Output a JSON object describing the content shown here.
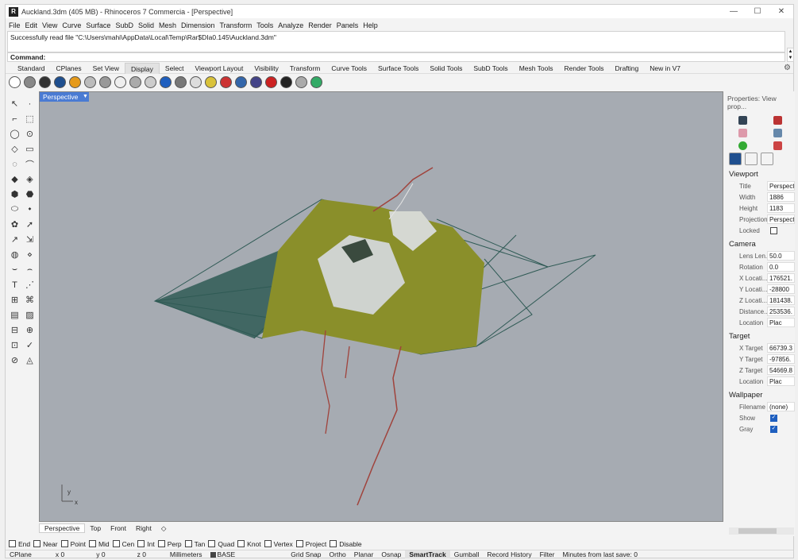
{
  "window": {
    "title": "Auckland.3dm (405 MB) - Rhinoceros 7 Commercia - [Perspective]",
    "app_icon": "rhino-icon",
    "min": "—",
    "max": "☐",
    "close": "✕"
  },
  "menu": [
    "File",
    "Edit",
    "View",
    "Curve",
    "Surface",
    "SubD",
    "Solid",
    "Mesh",
    "Dimension",
    "Transform",
    "Tools",
    "Analyze",
    "Render",
    "Panels",
    "Help"
  ],
  "command": {
    "history": "Successfully read file \"C:\\Users\\mahi\\AppData\\Local\\Temp\\Rar$DIa0.145\\Auckland.3dm\"",
    "prompt": "Command:"
  },
  "toolbar_tabs": [
    "Standard",
    "CPlanes",
    "Set View",
    "Display",
    "Select",
    "Viewport Layout",
    "Visibility",
    "Transform",
    "Curve Tools",
    "Surface Tools",
    "Solid Tools",
    "SubD Tools",
    "Mesh Tools",
    "Render Tools",
    "Drafting",
    "New in V7"
  ],
  "active_tab": "Display",
  "viewport": {
    "label": "Perspective",
    "axis_y": "y",
    "axis_x": "x",
    "dropdown_icon": "▼"
  },
  "viewport_tabs": [
    "Perspective",
    "Top",
    "Front",
    "Right"
  ],
  "viewport_tab_add": "◇",
  "osnaps": [
    {
      "label": "End",
      "on": false
    },
    {
      "label": "Near",
      "on": false
    },
    {
      "label": "Point",
      "on": false
    },
    {
      "label": "Mid",
      "on": false
    },
    {
      "label": "Cen",
      "on": false
    },
    {
      "label": "Int",
      "on": false
    },
    {
      "label": "Perp",
      "on": false
    },
    {
      "label": "Tan",
      "on": false
    },
    {
      "label": "Quad",
      "on": false
    },
    {
      "label": "Knot",
      "on": false
    },
    {
      "label": "Vertex",
      "on": false
    },
    {
      "label": "Project",
      "on": false
    },
    {
      "label": "Disable",
      "on": false
    }
  ],
  "status": {
    "cplane": "CPlane",
    "x": "x 0",
    "y": "y 0",
    "z": "z 0",
    "units": "Millimeters",
    "layer": "BASE",
    "items": [
      "Grid Snap",
      "Ortho",
      "Planar",
      "Osnap",
      "SmartTrack",
      "Gumball",
      "Record History",
      "Filter",
      "Minutes from last save: 0"
    ],
    "active": "SmartTrack"
  },
  "properties": {
    "title": "Properties: View prop...",
    "sections": [
      {
        "name": "Viewport",
        "rows": [
          [
            "Title",
            "Perspect"
          ],
          [
            "Width",
            "1886"
          ],
          [
            "Height",
            "1183"
          ],
          [
            "Projection",
            "Perspect"
          ],
          [
            "Locked",
            ""
          ]
        ]
      },
      {
        "name": "Camera",
        "rows": [
          [
            "Lens Len...",
            "50.0"
          ],
          [
            "Rotation",
            "0.0"
          ],
          [
            "X Locati...",
            "176521."
          ],
          [
            "Y Locati...",
            "-28800"
          ],
          [
            "Z Locati...",
            "181438."
          ],
          [
            "Distance...",
            "253536."
          ],
          [
            "Location",
            "Plac"
          ]
        ]
      },
      {
        "name": "Target",
        "rows": [
          [
            "X Target",
            "66739.3"
          ],
          [
            "Y Target",
            "-97856."
          ],
          [
            "Z Target",
            "54669.8"
          ],
          [
            "Location",
            "Plac"
          ]
        ]
      },
      {
        "name": "Wallpaper",
        "rows": [
          [
            "Filename",
            "(none)"
          ],
          [
            "Show",
            "✓"
          ],
          [
            "Gray",
            "✓"
          ]
        ]
      }
    ]
  },
  "colors": {
    "viewport_bg": "#a6abb2",
    "terrain_dark": "#2f5a55",
    "terrain_green": "#8a8f2a",
    "road_red": "#a0433c",
    "accent": "#4a7bd3"
  }
}
